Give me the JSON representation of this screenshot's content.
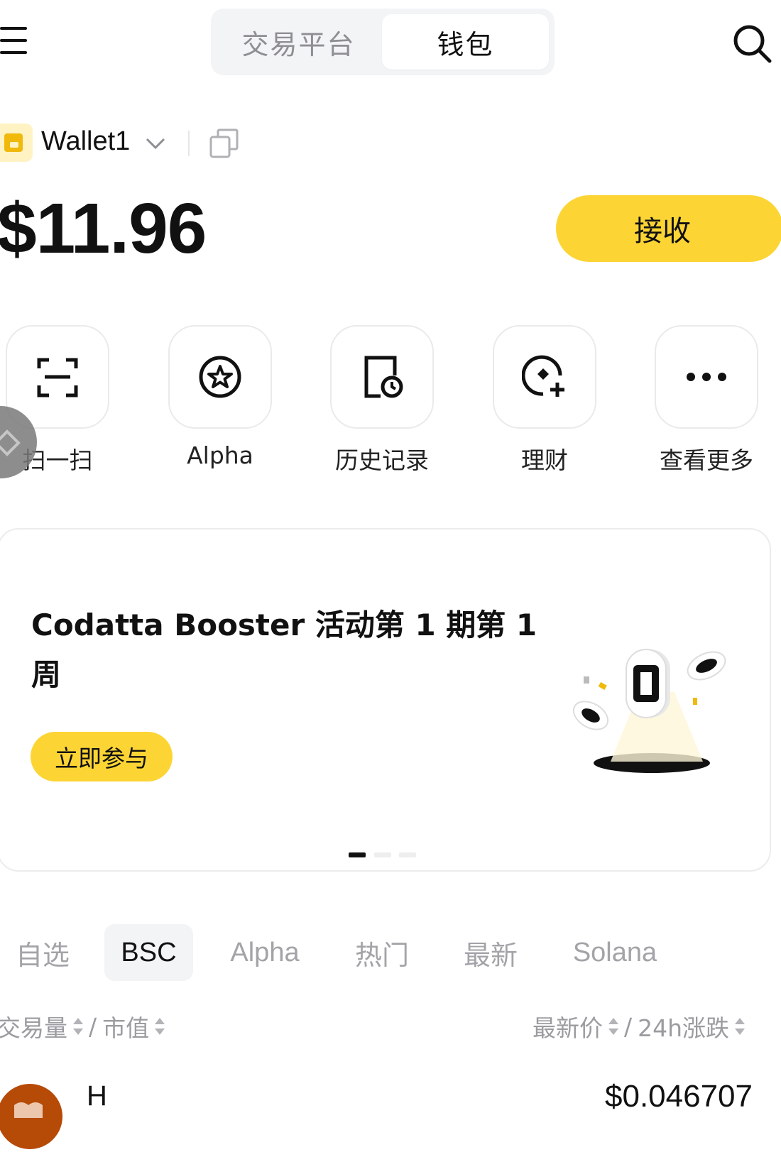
{
  "header": {
    "segments": [
      "交易平台",
      "钱包"
    ],
    "active_segment": "钱包"
  },
  "wallet": {
    "name": "Wallet1",
    "balance": "$11.96",
    "receive_label": "接收"
  },
  "quick_actions": [
    {
      "label": "扫一扫",
      "icon": "scan-icon"
    },
    {
      "label": "Alpha",
      "icon": "alpha-star-icon"
    },
    {
      "label": "历史记录",
      "icon": "history-icon"
    },
    {
      "label": "理财",
      "icon": "earn-icon"
    },
    {
      "label": "查看更多",
      "icon": "more-icon"
    }
  ],
  "banner": {
    "title": "Codatta Booster 活动第 1 期第 1 周",
    "button": "立即参与",
    "slides": 3,
    "active_slide": 1
  },
  "tabs": {
    "items": [
      "自选",
      "BSC",
      "Alpha",
      "热门",
      "最新",
      "Solana"
    ],
    "active": "BSC"
  },
  "columns": {
    "volume": "交易量",
    "sep1": "/",
    "mcap": "市值",
    "price": "最新价",
    "sep2": "/",
    "change": "24h涨跌"
  },
  "tokens": [
    {
      "symbol": "H",
      "price": "$0.046707"
    }
  ],
  "colors": {
    "accent": "#fcd535",
    "avatar": "#b64a07"
  }
}
